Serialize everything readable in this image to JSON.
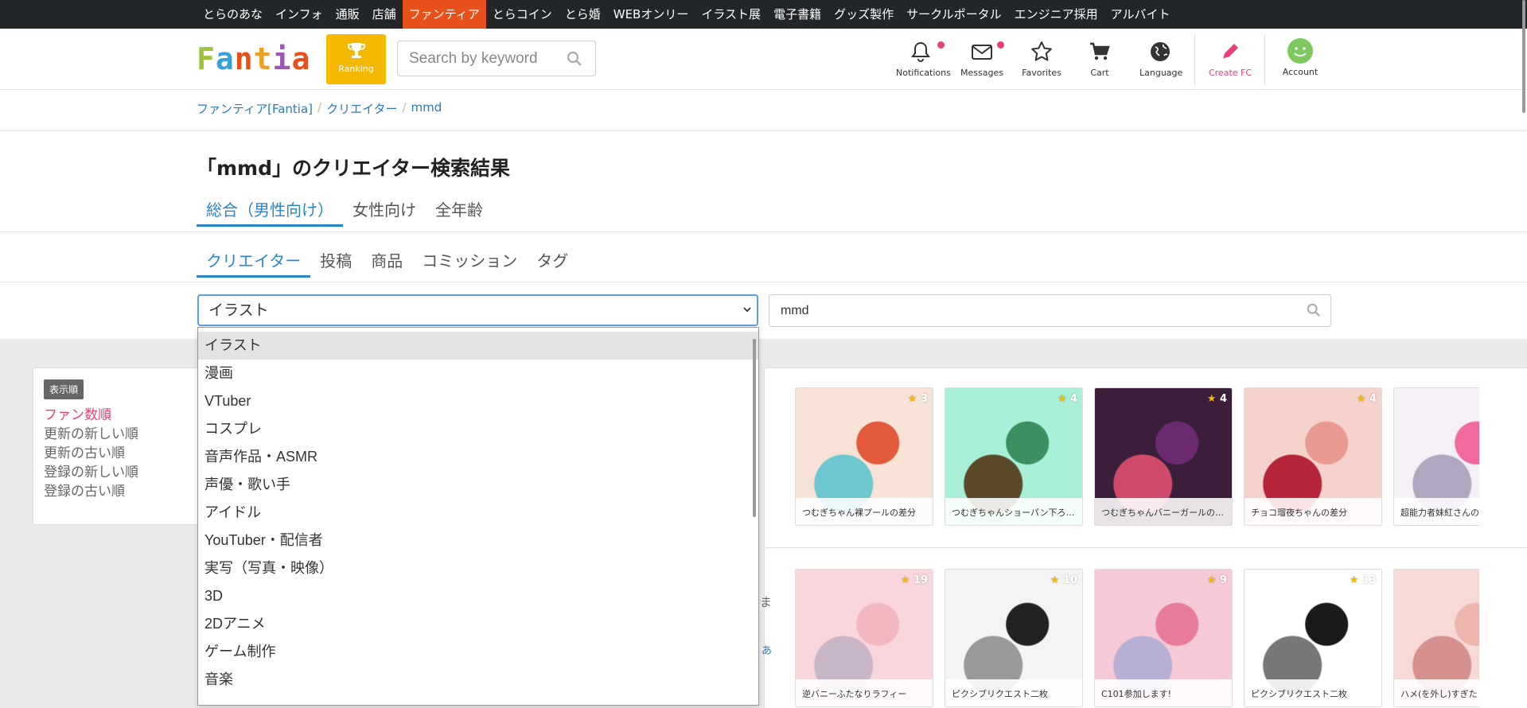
{
  "topnav": {
    "items": [
      "とらのあな",
      "インフォ",
      "通販",
      "店舗",
      "ファンティア",
      "とらコイン",
      "とら婚",
      "WEBオンリー",
      "イラスト展",
      "電子書籍",
      "グッズ製作",
      "サークルポータル",
      "エンジニア採用",
      "アルバイト"
    ],
    "active_index": 4
  },
  "header": {
    "logo_letters": [
      "F",
      "a",
      "n",
      "t",
      "i",
      "a"
    ],
    "logo_colors": [
      "#9bc43a",
      "#3aa0d8",
      "#e8501a",
      "#f0a020",
      "#9b59b6",
      "#e8501a"
    ],
    "ranking_label": "Ranking",
    "search_placeholder": "Search by keyword",
    "nav": {
      "notifications": "Notifications",
      "messages": "Messages",
      "favorites": "Favorites",
      "cart": "Cart",
      "language": "Language",
      "create_fc": "Create FC",
      "account": "Account"
    }
  },
  "breadcrumb": [
    "ファンティア[Fantia]",
    "クリエイター",
    "mmd"
  ],
  "page_title": "「mmd」のクリエイター検索結果",
  "audience_tabs": [
    "総合（男性向け）",
    "女性向け",
    "全年齢"
  ],
  "type_tabs": [
    "クリエイター",
    "投稿",
    "商品",
    "コミッション",
    "タグ"
  ],
  "category_select": {
    "value": "イラスト",
    "options": [
      "イラスト",
      "漫画",
      "VTuber",
      "コスプレ",
      "音声作品・ASMR",
      "声優・歌い手",
      "アイドル",
      "YouTuber・配信者",
      "実写（写真・映像）",
      "3D",
      "2Dアニメ",
      "ゲーム制作",
      "音楽"
    ]
  },
  "keyword_input": {
    "value": "mmd"
  },
  "sort": {
    "badge": "表示順",
    "options": [
      "ファン数順",
      "更新の新しい順",
      "更新の古い順",
      "登録の新しい順",
      "登録の古い順"
    ],
    "active_index": 0
  },
  "results": [
    {
      "posts": [
        {
          "stars": "3",
          "caption": "つむぎちゃん裸プールの差分"
        },
        {
          "stars": "4",
          "caption": "つむぎちゃんショーパン下ろ…"
        },
        {
          "stars": "4",
          "caption": "つむぎちゃんバニーガールの…"
        },
        {
          "stars": "4",
          "caption": "チョコ瑠夜ちゃんの差分"
        },
        {
          "stars": "",
          "caption": "超能力者妹紅さんの差"
        }
      ]
    },
    {
      "posts": [
        {
          "stars": "19",
          "caption": "逆バニーふたなりラフィー"
        },
        {
          "stars": "10",
          "caption": "ピクシブリクエスト二枚"
        },
        {
          "stars": "9",
          "caption": "C101参加します!"
        },
        {
          "stars": "13",
          "caption": "ピクシブリクエスト二枚"
        },
        {
          "stars": "",
          "caption": "ハメ(を外し)すぎたヒ"
        }
      ]
    }
  ],
  "side_fragments": [
    "ま",
    "あ"
  ]
}
